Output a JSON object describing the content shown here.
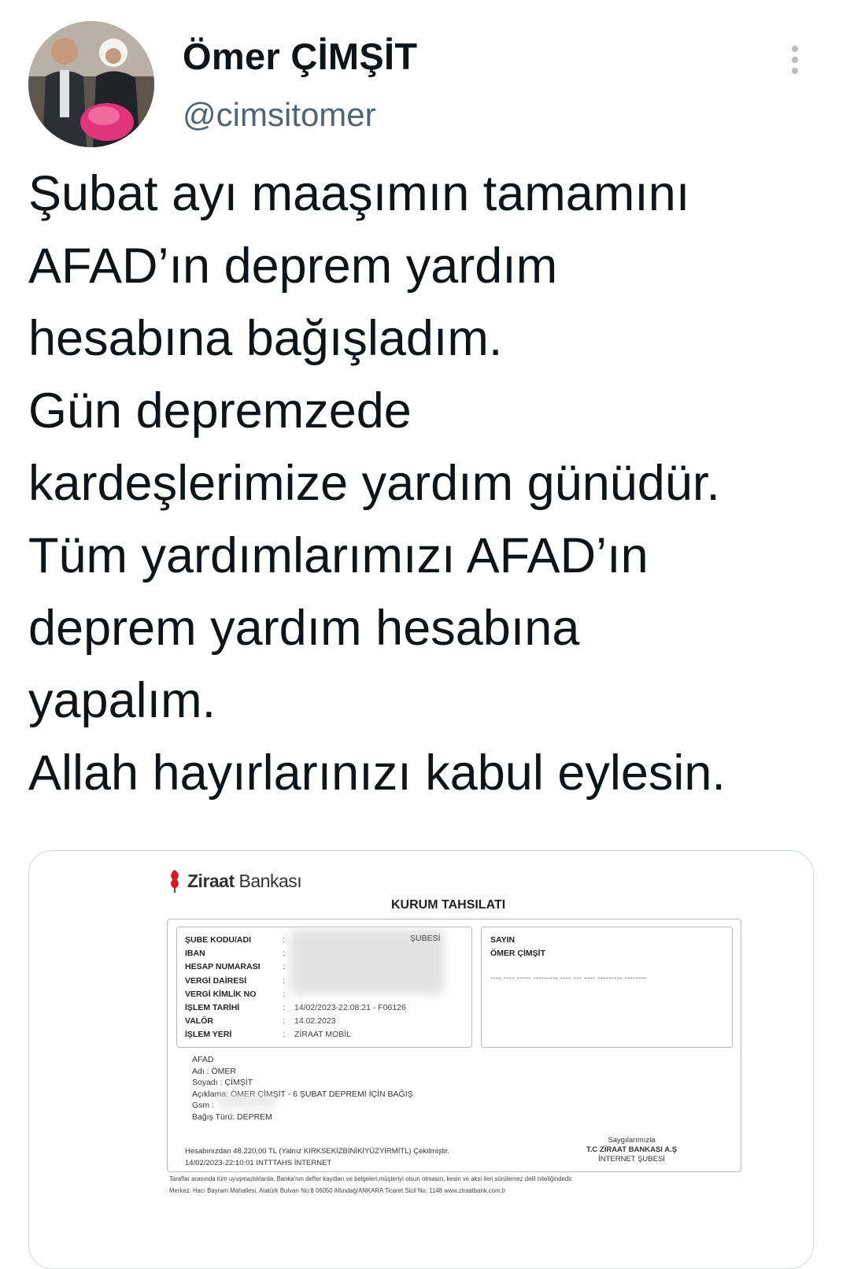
{
  "author": {
    "display_name": "Ömer ÇİMŞİT",
    "handle": "@cimsitomer"
  },
  "more_icon": "more-vertical-icon",
  "tweet_text": "Şubat ayı maaşımın tamamını\nAFAD’ın deprem yardım\nhesabına bağışladım.\nGün depremzede\nkardeşlerimize yardım günüdür.\nTüm yardımlarımızı AFAD’ın\ndeprem yardım hesabına\nyapalım.\nAllah hayırlarınızı kabul eylesin.",
  "receipt": {
    "bank_name_bold": "Ziraat",
    "bank_name_regular": " Bankası",
    "title": "KURUM TAHSILATI",
    "field_labels": [
      "ŞUBE KODU/ADI",
      "IBAN",
      "HESAP NUMARASI",
      "VERGİ DAİRESİ",
      "VERGİ KİMLİK NO",
      "İŞLEM TARİHİ",
      "VALÖR",
      "İŞLEM YERİ"
    ],
    "colons": [
      ":",
      ":",
      ":",
      ":",
      ":",
      ":",
      ":",
      ":"
    ],
    "sube_suffix": "ŞUBESİ",
    "islem_tarihi": "14/02/2023-22:08:21 - F06126",
    "valor": "14.02.2023",
    "islem_yeri": "ZİRAAT MOBİL",
    "sayin": "SAYIN",
    "recipient_name": "ÖMER ÇİMŞİT",
    "dashes": "---- ---- ----- --------- ---- --- ---- --------- --------",
    "afad_lines": [
      "AFAD",
      "Adı : ÖMER",
      "Soyadı : ÇİMŞİT",
      "Açıklama: ÖMER ÇİMŞİT - 6 ŞUBAT DEPREMİ İÇİN BAĞIŞ",
      "Gsm :",
      "Bağış Türü: DEPREM"
    ],
    "footer_amount": "Hesabınızdan 48.220,00 TL (Yalnız KIRKSEKİZBİNİKİYÜZYİRMİTL) Çekilmiştir.",
    "footer_datetime": "14/02/2023-22:10:01 INTTTAHS İNTERNET",
    "regards": "Saygılarımızla",
    "bank_signature": "T.C ZİRAAT BANKASI A.Ş",
    "branch": "İNTERNET ŞUBESİ",
    "legal_line1": "Taraflar arasında tüm uyuşmazlıklarda, Banka'nın defter kayıtları ve belgeleri,müşteriyi olsun olmasın, kesin ve aksi ileri sürülemez delil niteliğindedir.",
    "legal_line2": "Merkez: Hacı Bayram Mahallesi, Atatürk Bulvarı No:8 06050 Altındağ/ANKARA Ticaret Sicil No: 1148 www.ziraatbank.com.tr"
  }
}
